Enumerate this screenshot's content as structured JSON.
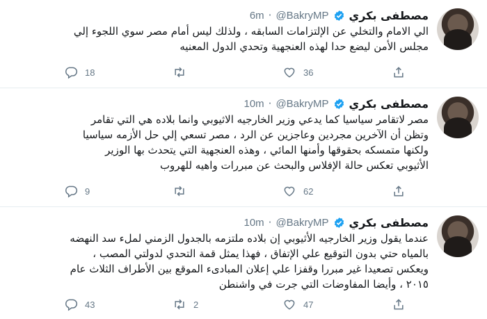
{
  "tweets": [
    {
      "name": "مصطفى بكري",
      "handle": "@BakryMP",
      "separator": "·",
      "time": "6m",
      "lines": [
        "الي الامام والتخلي عن الإلتزامات السابقه ، ولذلك ليس أمام مصر سوي اللجوء إلي",
        "مجلس الأمن ليضع حدا لهذه العنجهية وتحدي الدول المعنيه"
      ],
      "replies": "18",
      "retweets": "",
      "likes": "36"
    },
    {
      "name": "مصطفى بكري",
      "handle": "@BakryMP",
      "separator": "·",
      "time": "10m",
      "lines": [
        "مصر لاتقامر سياسيا كما يدعي وزير الخارجيه الاثيوبي وانما بلاده هي التي تقامر",
        "وتظن أن الآخرين مجردين وعاجزين عن الرد ، مصر تسعي إلي حل الأزمه سياسيا",
        "ولكنها متمسكه بحقوقها وأمنها المائي ، وهذه العنجهية التي يتحدث بها الوزير",
        "الأثيوبي تعكس حالة الإفلاس والبحث عن مبررات واهيه للهروب"
      ],
      "replies": "9",
      "retweets": "",
      "likes": "62"
    },
    {
      "name": "مصطفى بكري",
      "handle": "@BakryMP",
      "separator": "·",
      "time": "10m",
      "lines": [
        "عندما يقول وزير الخارجيه الأثيوبي إن بلاده ملتزمه بالجدول الزمني لملء سد النهضه",
        "بالمياه حتي بدون التوقيع علي الإتفاق ، فهذا يمثل قمة التحدي لدولتي المصب ،",
        "ويعكس تصعيدا غير مبررا وقفزا علي إعلان المبادىء الموقع بين الأطراف الثلاث عام",
        "٢٠١٥ ، وأيضا المفاوضات التي جرت في واشنطن"
      ],
      "replies": "43",
      "retweets": "2",
      "likes": "47"
    }
  ],
  "icons": {
    "verified_color": "#1da1f2",
    "action_color": "#657786"
  }
}
